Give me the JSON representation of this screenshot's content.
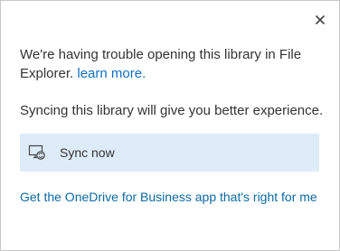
{
  "dialog": {
    "close_icon": "close-icon",
    "message_text": "We're having trouble opening this library in File Explorer.",
    "learn_more_label": "learn more.",
    "sub_message": "Syncing this library will give you better experience.",
    "sync_button": {
      "icon": "sync-monitor-icon",
      "label": "Sync now"
    },
    "app_link": "Get the OneDrive for Business app that's right for me"
  },
  "colors": {
    "link": "#106ebe",
    "sync_button_bg": "#deecf9",
    "text": "#333333",
    "border": "#c8c8c8"
  }
}
